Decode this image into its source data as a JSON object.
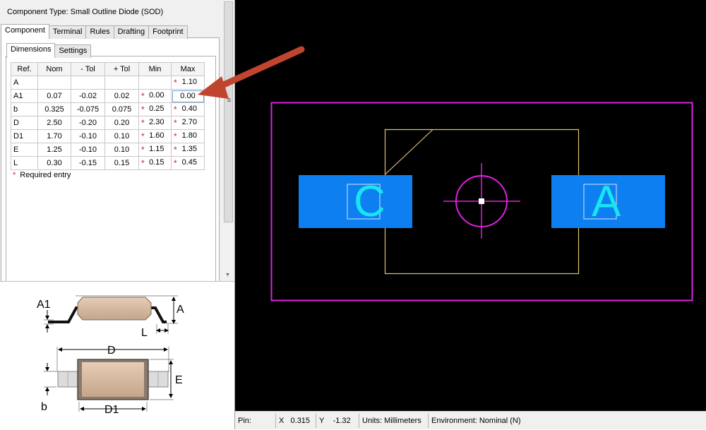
{
  "dialog": {
    "component_type": "Component Type: Small Outline Diode (SOD)",
    "main_tabs": [
      "Component",
      "Terminal",
      "Rules",
      "Drafting",
      "Footprint"
    ],
    "sub_tabs": [
      "Dimensions",
      "Settings"
    ],
    "table": {
      "headers": [
        "Ref.",
        "Nom",
        "- Tol",
        "+ Tol",
        "Min",
        "Max"
      ],
      "rows": [
        {
          "ref": "A",
          "nom": "",
          "mtol": "",
          "ptol": "",
          "min": "",
          "max": "1.10",
          "min_req": false,
          "max_req": true
        },
        {
          "ref": "A1",
          "nom": "0.07",
          "mtol": "-0.02",
          "ptol": "0.02",
          "min": "0.00",
          "max": "0.00",
          "min_req": true,
          "max_req": false
        },
        {
          "ref": "b",
          "nom": "0.325",
          "mtol": "-0.075",
          "ptol": "0.075",
          "min": "0.25",
          "max": "0.40",
          "min_req": true,
          "max_req": true
        },
        {
          "ref": "D",
          "nom": "2.50",
          "mtol": "-0.20",
          "ptol": "0.20",
          "min": "2.30",
          "max": "2.70",
          "min_req": true,
          "max_req": true
        },
        {
          "ref": "D1",
          "nom": "1.70",
          "mtol": "-0.10",
          "ptol": "0.10",
          "min": "1.60",
          "max": "1.80",
          "min_req": true,
          "max_req": true
        },
        {
          "ref": "E",
          "nom": "1.25",
          "mtol": "-0.10",
          "ptol": "0.10",
          "min": "1.15",
          "max": "1.35",
          "min_req": true,
          "max_req": true
        },
        {
          "ref": "L",
          "nom": "0.30",
          "mtol": "-0.15",
          "ptol": "0.15",
          "min": "0.15",
          "max": "0.45",
          "min_req": true,
          "max_req": true
        }
      ]
    },
    "required_note_star": "*",
    "required_note": "Required entry",
    "scroll_grip": "≡",
    "scroll_down_glyph": "▼"
  },
  "diagram": {
    "labels": {
      "A1": "A1",
      "A": "A",
      "L": "L",
      "D": "D",
      "E": "E",
      "b": "b",
      "D1": "D1"
    }
  },
  "canvas": {
    "pin_left_label": "C",
    "pin_right_label": "A",
    "colors": {
      "background": "#000000",
      "courtyard": "#e020e0",
      "silkscreen": "#e0c070",
      "pad": "#0d7ff0",
      "pin_label": "#17e6f0",
      "origin": "#e020e0"
    }
  },
  "status_bar": {
    "pin_label": "Pin:",
    "x_label": "X",
    "x_value": "0.315",
    "y_label": "Y",
    "y_value": "-1.32",
    "units": "Units: Millimeters",
    "environment": "Environment: Nominal (N)"
  },
  "annotation": {
    "arrow_color": "#c0452f"
  }
}
